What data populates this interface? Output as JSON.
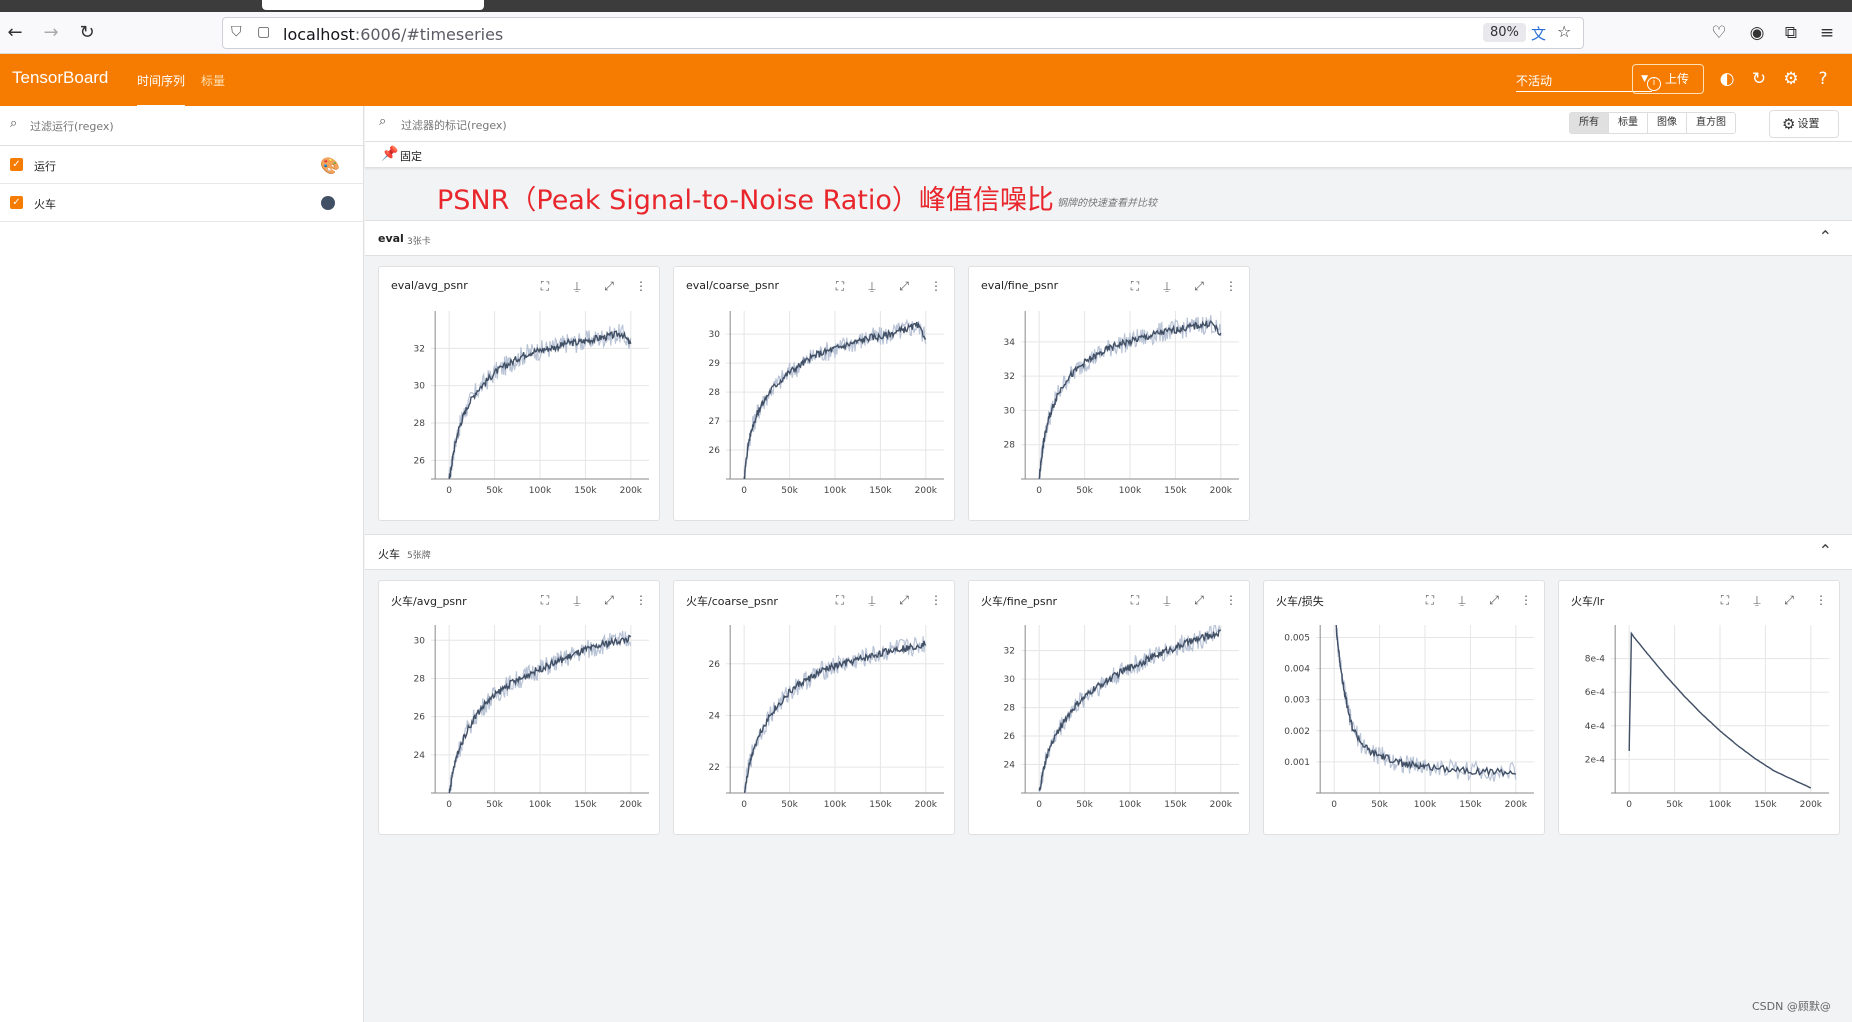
{
  "browser": {
    "url_host": "localhost",
    "url_rest": ":6006/#timeseries",
    "zoom": "80%"
  },
  "header": {
    "app_title": "TensorBoard",
    "tabs": [
      "时间序列",
      "标量"
    ],
    "status_select": "不活动",
    "upload_label": "上传"
  },
  "runs": {
    "filter_placeholder": "过滤运行(regex)",
    "items": [
      {
        "label": "运行"
      },
      {
        "label": "火车"
      }
    ]
  },
  "main": {
    "tag_filter_placeholder": "过滤器的标记(regex)",
    "type_toggle": [
      "所有",
      "标量",
      "图像",
      "直方图"
    ],
    "settings_label": "设置",
    "pinned_label": "固定",
    "annotation": "PSNR（Peak Signal-to-Noise Ratio）峰值信噪比",
    "annotation_sub": "钢牌的快速查看并比较",
    "groups": [
      {
        "name": "eval",
        "count": "3张卡"
      },
      {
        "name": "火车",
        "count": "5张牌"
      }
    ]
  },
  "watermark": "CSDN @顾默@",
  "colors": {
    "accent": "#f57c00",
    "series": "#425066",
    "series_raw": "#b9c3d6"
  },
  "chart_data": [
    {
      "type": "line",
      "title": "eval/avg_psnr",
      "x_ticks": [
        "0",
        "50k",
        "100k",
        "150k",
        "200k"
      ],
      "y_ticks": [
        "26",
        "28",
        "30",
        "32"
      ],
      "xlim": [
        -20000,
        220000
      ],
      "ylim": [
        25,
        34
      ],
      "series": [
        {
          "x": [
            0,
            2000,
            5000,
            10000,
            15000,
            20000,
            30000,
            40000,
            50000,
            60000,
            70000,
            80000,
            90000,
            100000,
            110000,
            120000,
            130000,
            140000,
            150000,
            160000,
            170000,
            180000,
            190000,
            200000
          ],
          "y": [
            25,
            25.5,
            26.5,
            27.6,
            28.3,
            28.9,
            29.7,
            30.2,
            30.7,
            31,
            31.3,
            31.6,
            31.8,
            31.9,
            32,
            32.1,
            32.3,
            32.3,
            32.4,
            32.5,
            32.6,
            32.7,
            32.8,
            32.2
          ]
        }
      ]
    },
    {
      "type": "line",
      "title": "eval/coarse_psnr",
      "x_ticks": [
        "0",
        "50k",
        "100k",
        "150k",
        "200k"
      ],
      "y_ticks": [
        "26",
        "27",
        "28",
        "29",
        "30"
      ],
      "xlim": [
        -20000,
        220000
      ],
      "ylim": [
        25,
        30.8
      ],
      "series": [
        {
          "x": [
            0,
            2000,
            5000,
            10000,
            15000,
            20000,
            30000,
            40000,
            50000,
            60000,
            70000,
            80000,
            90000,
            100000,
            110000,
            120000,
            130000,
            140000,
            150000,
            160000,
            170000,
            180000,
            190000,
            200000
          ],
          "y": [
            25,
            25.6,
            26.3,
            26.9,
            27.3,
            27.6,
            28.1,
            28.4,
            28.7,
            28.9,
            29.1,
            29.3,
            29.4,
            29.5,
            29.6,
            29.7,
            29.8,
            29.9,
            29.9,
            30,
            30.1,
            30.2,
            30.3,
            29.9
          ]
        }
      ]
    },
    {
      "type": "line",
      "title": "eval/fine_psnr",
      "x_ticks": [
        "0",
        "50k",
        "100k",
        "150k",
        "200k"
      ],
      "y_ticks": [
        "28",
        "30",
        "32",
        "34"
      ],
      "xlim": [
        -20000,
        220000
      ],
      "ylim": [
        26,
        35.8
      ],
      "series": [
        {
          "x": [
            0,
            2000,
            5000,
            10000,
            15000,
            20000,
            30000,
            40000,
            50000,
            60000,
            70000,
            80000,
            90000,
            100000,
            110000,
            120000,
            130000,
            140000,
            150000,
            160000,
            170000,
            180000,
            190000,
            200000
          ],
          "y": [
            26,
            27,
            28.2,
            29.4,
            30.2,
            30.9,
            31.8,
            32.3,
            32.8,
            33.1,
            33.4,
            33.7,
            33.9,
            34,
            34.2,
            34.3,
            34.5,
            34.6,
            34.7,
            34.8,
            34.9,
            35,
            35.1,
            34.4
          ]
        }
      ]
    },
    {
      "type": "line",
      "title": "火车/avg_psnr",
      "x_ticks": [
        "0",
        "50k",
        "100k",
        "150k",
        "200k"
      ],
      "y_ticks": [
        "24",
        "26",
        "28",
        "30"
      ],
      "xlim": [
        -20000,
        220000
      ],
      "ylim": [
        22,
        30.8
      ],
      "series": [
        {
          "x": [
            0,
            5000,
            10000,
            20000,
            30000,
            40000,
            50000,
            60000,
            70000,
            80000,
            90000,
            100000,
            110000,
            120000,
            130000,
            140000,
            150000,
            160000,
            170000,
            180000,
            190000,
            200000
          ],
          "y": [
            22,
            23.3,
            24.2,
            25.3,
            26.1,
            26.7,
            27.1,
            27.5,
            27.8,
            28,
            28.3,
            28.5,
            28.7,
            28.9,
            29.1,
            29.3,
            29.5,
            29.6,
            29.8,
            29.9,
            30,
            30.1
          ]
        }
      ]
    },
    {
      "type": "line",
      "title": "火车/coarse_psnr",
      "x_ticks": [
        "0",
        "50k",
        "100k",
        "150k",
        "200k"
      ],
      "y_ticks": [
        "22",
        "24",
        "26"
      ],
      "xlim": [
        -20000,
        220000
      ],
      "ylim": [
        21,
        27.5
      ],
      "series": [
        {
          "x": [
            0,
            5000,
            10000,
            20000,
            30000,
            40000,
            50000,
            60000,
            70000,
            80000,
            90000,
            100000,
            110000,
            120000,
            130000,
            140000,
            150000,
            160000,
            170000,
            180000,
            190000,
            200000
          ],
          "y": [
            21,
            22,
            22.7,
            23.5,
            24.1,
            24.5,
            24.9,
            25.2,
            25.4,
            25.6,
            25.8,
            25.9,
            26,
            26.1,
            26.2,
            26.3,
            26.4,
            26.5,
            26.6,
            26.6,
            26.7,
            26.8
          ]
        }
      ]
    },
    {
      "type": "line",
      "title": "火车/fine_psnr",
      "x_ticks": [
        "0",
        "50k",
        "100k",
        "150k",
        "200k"
      ],
      "y_ticks": [
        "24",
        "26",
        "28",
        "30",
        "32"
      ],
      "xlim": [
        -20000,
        220000
      ],
      "ylim": [
        22,
        33.8
      ],
      "series": [
        {
          "x": [
            0,
            5000,
            10000,
            20000,
            30000,
            40000,
            50000,
            60000,
            70000,
            80000,
            90000,
            100000,
            110000,
            120000,
            130000,
            140000,
            150000,
            160000,
            170000,
            180000,
            190000,
            200000
          ],
          "y": [
            22,
            23.7,
            24.9,
            26.3,
            27.3,
            28.1,
            28.7,
            29.3,
            29.7,
            30.1,
            30.5,
            30.8,
            31.1,
            31.4,
            31.7,
            32,
            32.2,
            32.5,
            32.7,
            32.9,
            33.1,
            33.3
          ]
        }
      ]
    },
    {
      "type": "line",
      "title": "火车/损失",
      "x_ticks": [
        "0",
        "50k",
        "100k",
        "150k",
        "200k"
      ],
      "y_ticks": [
        "0.001",
        "0.002",
        "0.003",
        "0.004",
        "0.005"
      ],
      "xlim": [
        -20000,
        220000
      ],
      "ylim": [
        0,
        0.0054
      ],
      "series": [
        {
          "x": [
            2000,
            5000,
            10000,
            15000,
            20000,
            30000,
            40000,
            50000,
            60000,
            70000,
            80000,
            90000,
            100000,
            120000,
            140000,
            160000,
            180000,
            200000
          ],
          "y": [
            0.0054,
            0.0045,
            0.0035,
            0.0027,
            0.0021,
            0.0016,
            0.0013,
            0.0012,
            0.0011,
            0.001,
            0.0009,
            0.0009,
            0.00085,
            0.0008,
            0.00075,
            0.0007,
            0.00068,
            0.00065
          ]
        }
      ]
    },
    {
      "type": "line",
      "title": "火车/lr",
      "x_ticks": [
        "0",
        "50k",
        "100k",
        "150k",
        "200k"
      ],
      "y_ticks": [
        "2e-4",
        "4e-4",
        "6e-4",
        "8e-4"
      ],
      "xlim": [
        -20000,
        220000
      ],
      "ylim": [
        0,
        0.001
      ],
      "series": [
        {
          "x": [
            0,
            2500,
            5000,
            20000,
            40000,
            60000,
            80000,
            100000,
            120000,
            140000,
            160000,
            180000,
            200000
          ],
          "y": [
            0.00025,
            0.00095,
            0.00093,
            0.00083,
            0.0007,
            0.00058,
            0.00047,
            0.00037,
            0.00028,
            0.0002,
            0.00013,
            8e-05,
            3e-05
          ]
        }
      ]
    }
  ]
}
